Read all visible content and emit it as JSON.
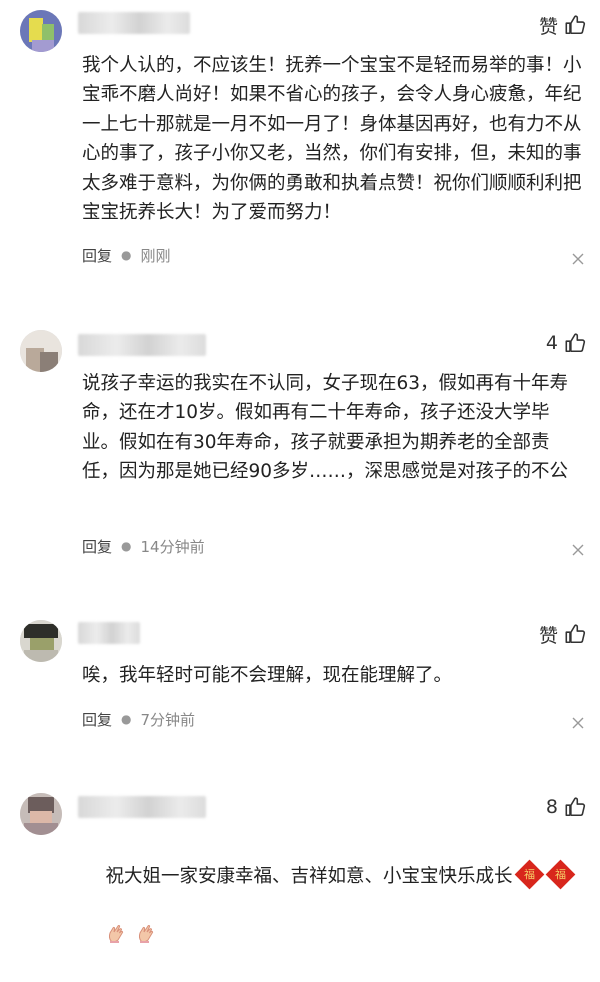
{
  "comments": [
    {
      "like_label": "赞",
      "text": "我个人认的，不应该生！抚养一个宝宝不是轻而易举的事！小宝乖不磨人尚好！如果不省心的孩子，会令人身心疲惫，年纪一上七十那就是一月不如一月了！身体基因再好，也有力不从心的事了，孩子小你又老，当然，你们有安排，但，未知的事太多难于意料，为你俩的勇敢和执着点赞！祝你们顺顺利利把宝宝抚养长大！为了爱而努力！",
      "reply_label": "回复",
      "time": "刚刚"
    },
    {
      "like_label": "4",
      "text": "说孩子幸运的我实在不认同，女子现在63，假如再有十年寿命，还在才10岁。假如再有二十年寿命，孩子还没大学毕业。假如在有30年寿命，孩子就要承担为期养老的全部责任，因为那是她已经90多岁……，深思感觉是对孩子的不公",
      "reply_label": "回复",
      "time": "14分钟前"
    },
    {
      "like_label": "赞",
      "text": "唉，我年轻时可能不会理解，现在能理解了。",
      "reply_label": "回复",
      "time": "7分钟前"
    },
    {
      "like_label": "8",
      "text": "祝大姐一家安康幸福、吉祥如意、小宝宝快乐成长",
      "emoji_fu_char": "福"
    }
  ],
  "icons": {
    "thumb": "thumb-up-icon",
    "close": "close-icon",
    "fu": "fu-blessing-emoji",
    "hand": "clasped-hands-emoji"
  }
}
